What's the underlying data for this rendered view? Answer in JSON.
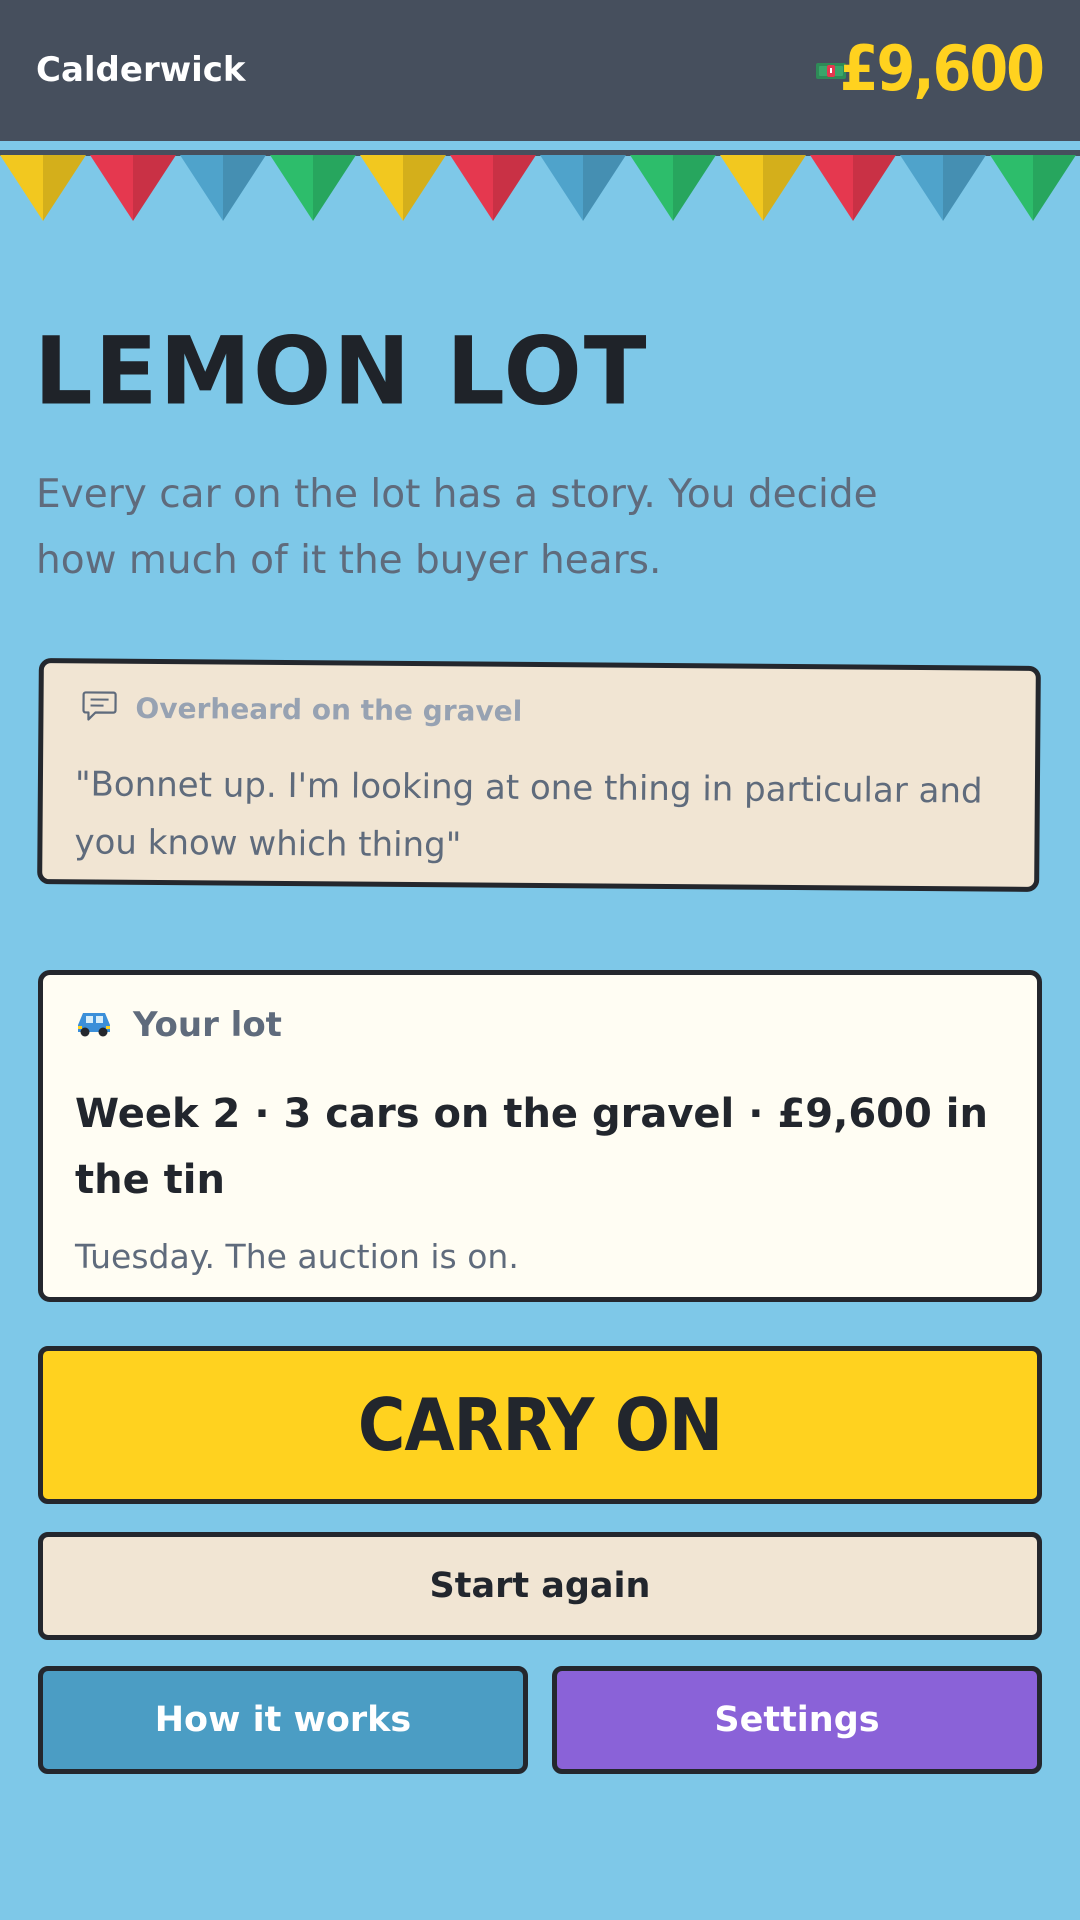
{
  "header": {
    "town": "Calderwick",
    "cash": "£9,600",
    "cash_icon": "banknote-icon",
    "background": "#464f5d",
    "cash_color": "#ffd21f"
  },
  "bunting_colors": [
    "#f2c81f",
    "#e5384f",
    "#4fa3cb",
    "#2dbd6b"
  ],
  "title": "LEMON LOT",
  "tagline": "Every car on the lot has a story. You decide how much of it the buyer hears.",
  "overheard": {
    "icon": "speech-bubble-icon",
    "label": "Overheard on the gravel",
    "quote": "\"Bonnet up. I'm looking at one thing in particular and you know which thing\""
  },
  "lot": {
    "icon": "car-icon",
    "label": "Your lot",
    "week": "Week 2",
    "cars": "3 cars on the gravel",
    "tin": "£9,600 in the tin",
    "separator": "·",
    "note": "Tuesday. The auction is on."
  },
  "buttons": {
    "carry_on": "CARRY ON",
    "start_again": "Start again",
    "how_it_works": "How it works",
    "settings": "Settings"
  }
}
